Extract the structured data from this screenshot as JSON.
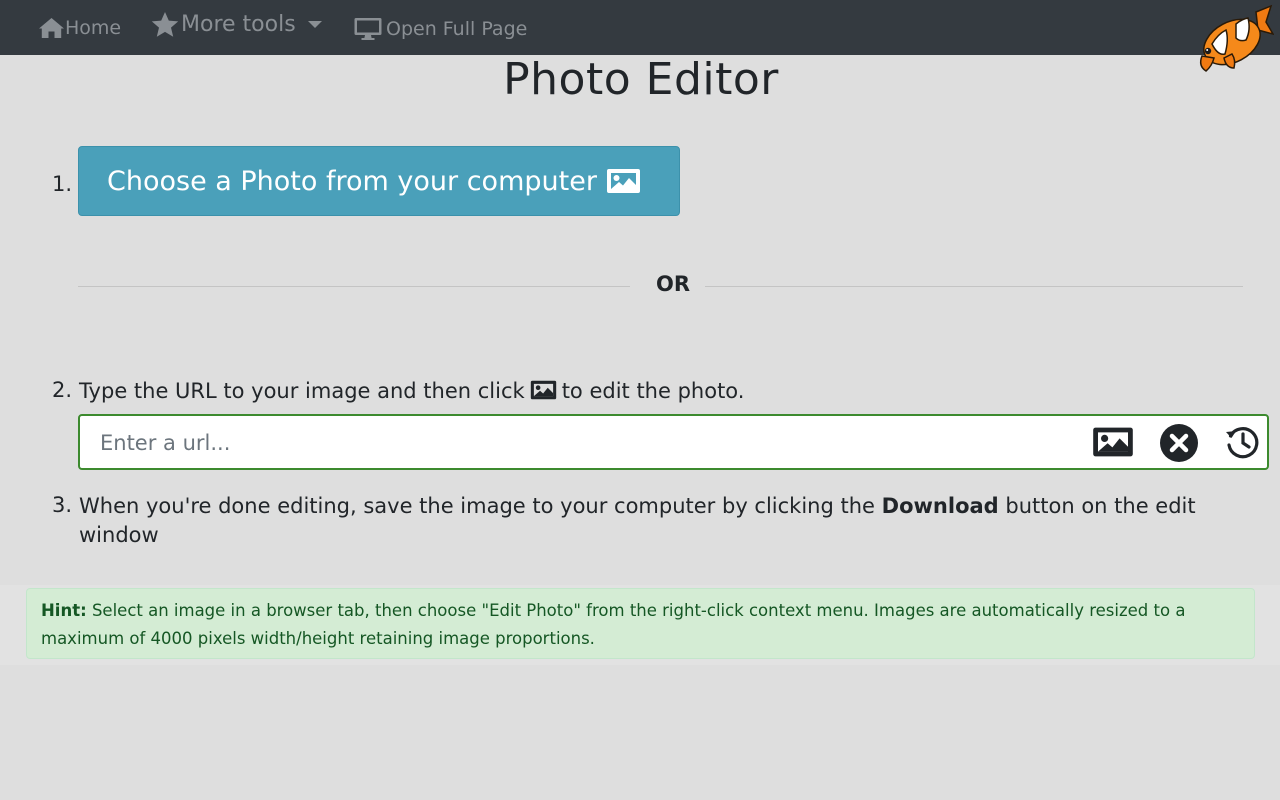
{
  "nav": {
    "home_label": "Home",
    "more_tools_label": "More tools",
    "open_full_page_label": "Open Full Page"
  },
  "page_title": "Photo Editor",
  "step1": {
    "number": "1.",
    "button_label": "Choose a Photo from your computer"
  },
  "divider_text": "OR",
  "step2": {
    "number": "2.",
    "text_before_icon": "Type the URL to your image and then click",
    "text_after_icon": "to edit the photo.",
    "url_placeholder": "Enter a url...",
    "url_value": ""
  },
  "step3": {
    "number": "3.",
    "text_before": "When you're done editing, save the image to your computer by clicking the",
    "bold_word": "Download",
    "text_after": "button on the edit window"
  },
  "hint": {
    "label": "Hint:",
    "text": "Select an image in a browser tab, then choose \"Edit Photo\" from the right-click context menu. Images are automatically resized to a maximum of 4000 pixels width/height retaining image proportions."
  },
  "colors": {
    "navbar": "#343a40",
    "button_accent": "#4aa0ba",
    "input_border": "#3c8a2e",
    "hint_background": "#d4ecd4",
    "hint_text": "#155724"
  },
  "icons": [
    "home-icon",
    "star-icon",
    "chevron-down-icon",
    "monitor-icon",
    "clownfish-logo",
    "image-icon",
    "close-circle-icon",
    "history-icon"
  ]
}
